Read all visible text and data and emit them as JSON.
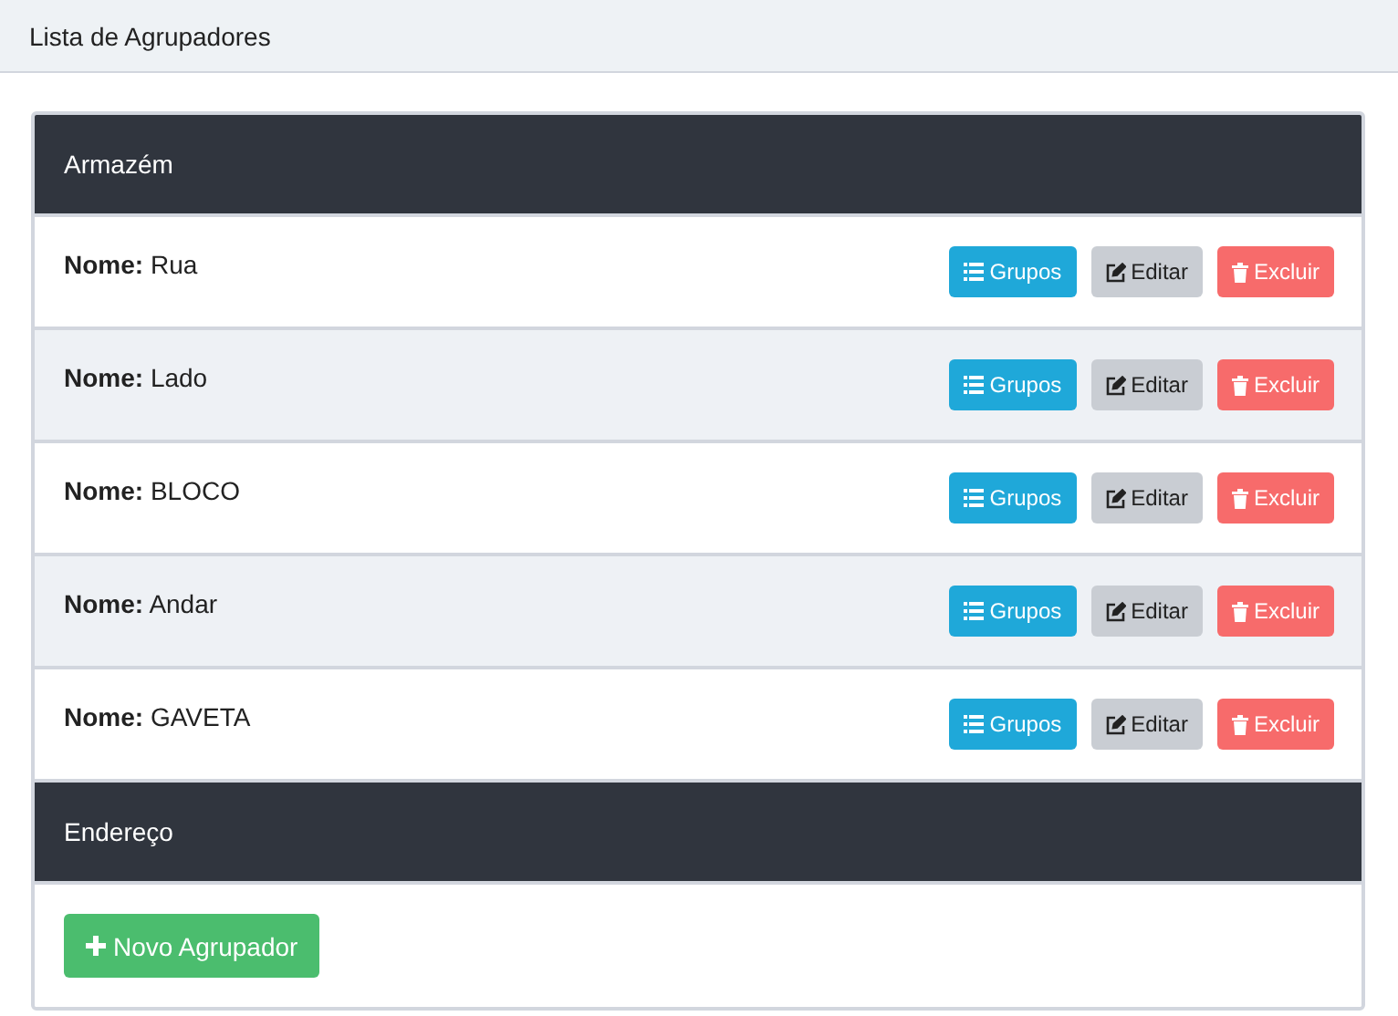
{
  "page_title": "Lista de Agrupadores",
  "sections": [
    {
      "title": "Armazém",
      "rows": [
        {
          "label": "Nome:",
          "value": "Rua",
          "buttons": [
            {
              "kind": "groups",
              "label": "Grupos"
            },
            {
              "kind": "edit",
              "label": "Editar"
            },
            {
              "kind": "delete",
              "label": "Excluir"
            }
          ]
        },
        {
          "label": "Nome:",
          "value": "Lado",
          "buttons": [
            {
              "kind": "groups",
              "label": "Grupos"
            },
            {
              "kind": "edit",
              "label": "Editar"
            },
            {
              "kind": "delete",
              "label": "Excluir"
            }
          ]
        },
        {
          "label": "Nome:",
          "value": "BLOCO",
          "buttons": [
            {
              "kind": "groups",
              "label": "Grupos"
            },
            {
              "kind": "edit",
              "label": "Editar"
            },
            {
              "kind": "delete",
              "label": "Excluir"
            }
          ]
        },
        {
          "label": "Nome:",
          "value": "Andar",
          "buttons": [
            {
              "kind": "groups",
              "label": "Grupos"
            },
            {
              "kind": "edit",
              "label": "Editar"
            },
            {
              "kind": "delete",
              "label": "Excluir"
            }
          ]
        },
        {
          "label": "Nome:",
          "value": "GAVETA",
          "buttons": [
            {
              "kind": "groups",
              "label": "Grupos"
            },
            {
              "kind": "edit",
              "label": "Editar"
            },
            {
              "kind": "delete",
              "label": "Excluir"
            }
          ]
        }
      ]
    },
    {
      "title": "Endereço"
    }
  ],
  "add_button": "Novo Agrupador"
}
